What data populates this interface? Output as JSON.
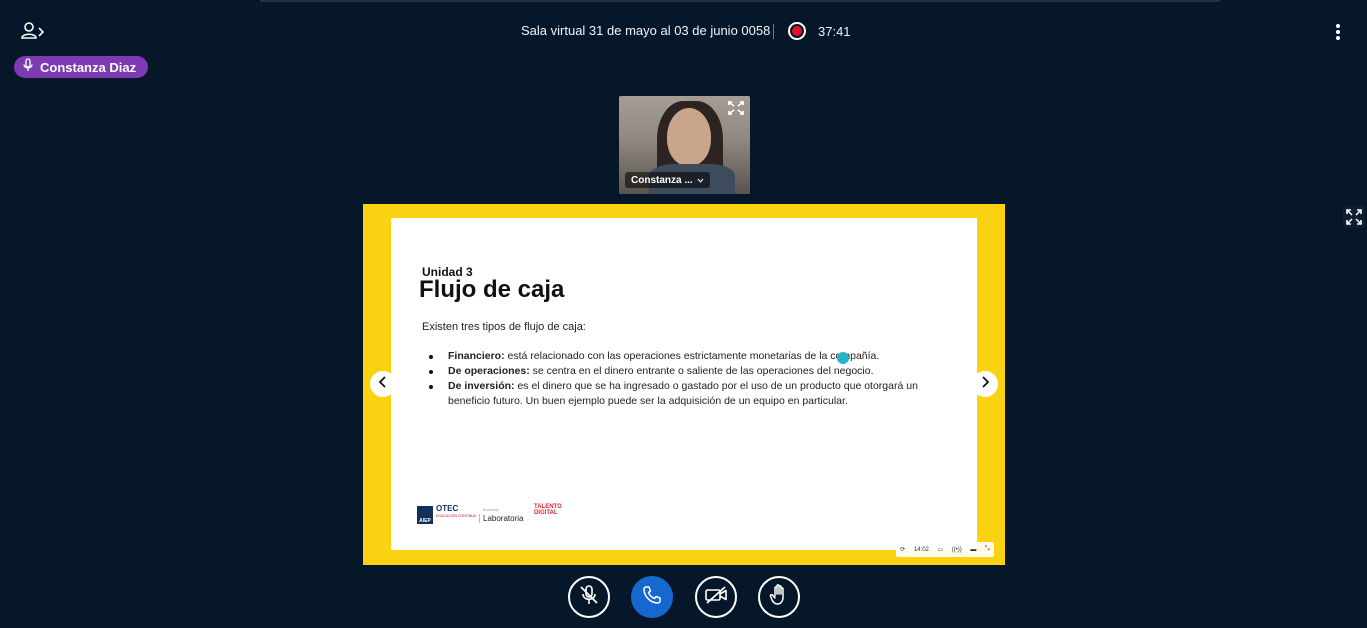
{
  "meeting": {
    "title": "Sala virtual 31 de mayo al 03 de junio 0058",
    "recording_time": "37:41",
    "recording_color": "#e0102a"
  },
  "talking_indicator": {
    "name": "Constanza Diaz",
    "icon": "microphone-icon",
    "color": "#7d3ab3"
  },
  "webcam": {
    "name": "Constanza ...",
    "expand_icon": "expand-icon"
  },
  "slide": {
    "unit": "Unidad 3",
    "title": "Flujo de caja",
    "intro": "Existen tres tipos de flujo de caja:",
    "items": [
      {
        "term": "Financiero:",
        "text": " está relacionado con las operaciones estrictamente monetarias de la compañía."
      },
      {
        "term": "De operaciones:",
        "text": " se centra en el dinero entrante o saliente de las operaciones del negocio."
      },
      {
        "term": "De inversión:",
        "text": " es el dinero que se ha ingresado o gastado por el uso de un producto que otorgará un beneficio futuro. Un buen ejemplo puede ser la adquisición de un equipo en particular."
      }
    ],
    "logos": {
      "aep": "AIEP",
      "otec": "OTEC",
      "otec_sub": "EDUCACIÓN CONTINUA",
      "laboratoria_pre": "Bootcamp",
      "laboratoria": "Laboratoria",
      "talento": "TALENTO DIGITAL"
    },
    "player_time": "14:02",
    "frame_color": "#fbd212"
  },
  "actions": {
    "mic": "unmute-microphone",
    "leave": "leave-audio",
    "camera": "share-webcam",
    "hand": "raise-hand",
    "leave_color": "#1468d0"
  }
}
